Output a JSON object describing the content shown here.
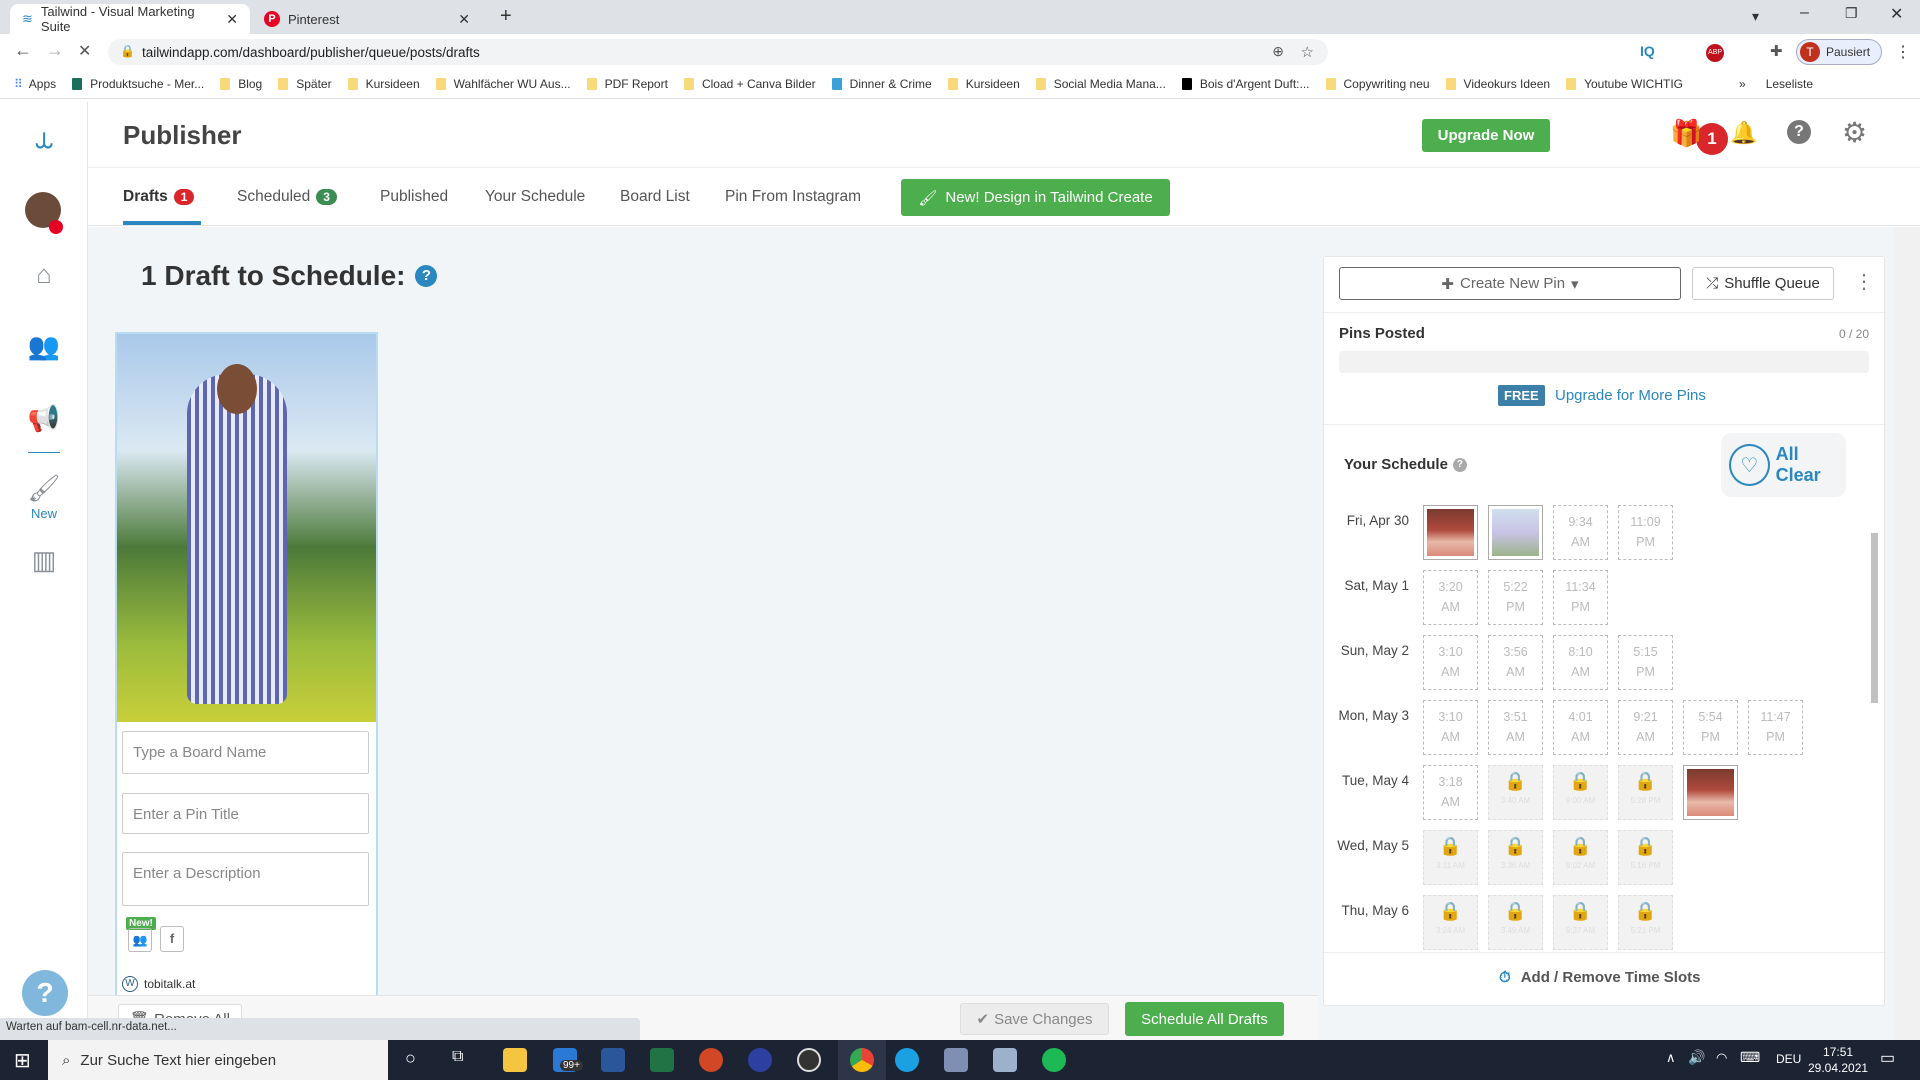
{
  "browser": {
    "tabs": [
      {
        "title": "Tailwind - Visual Marketing Suite",
        "active": true
      },
      {
        "title": "Pinterest",
        "active": false
      }
    ],
    "url": "tailwindapp.com/dashboard/publisher/queue/posts/drafts",
    "profile_label": "Pausiert",
    "profile_initial": "T",
    "bookmarks": [
      "Apps",
      "Produktsuche - Mer...",
      "Blog",
      "Später",
      "Kursideen",
      "Wahlfächer WU Aus...",
      "PDF Report",
      "Cload + Canva Bilder",
      "Dinner & Crime",
      "Kursideen",
      "Social Media Mana...",
      "Bois d'Argent Duft:...",
      "Copywriting neu",
      "Videokurs Ideen",
      "Youtube WICHTIG"
    ],
    "reading_list": "Leseliste",
    "status_text": "Warten auf bam-cell.nr-data.net..."
  },
  "sidebar": {
    "new_label": "New"
  },
  "header": {
    "title": "Publisher",
    "upgrade_label": "Upgrade Now",
    "notification_count": "1"
  },
  "tabs": [
    {
      "label": "Drafts",
      "count": "1",
      "active": true
    },
    {
      "label": "Scheduled",
      "count": "3"
    },
    {
      "label": "Published"
    },
    {
      "label": "Your Schedule"
    },
    {
      "label": "Board List"
    },
    {
      "label": "Pin From Instagram"
    }
  ],
  "design_button": "New! Design in Tailwind Create",
  "drafts": {
    "heading": "1 Draft to Schedule:",
    "board_placeholder": "Type a Board Name",
    "title_placeholder": "Enter a Pin Title",
    "description_placeholder": "Enter a Description",
    "new_badge": "New!",
    "site": "tobitalk.at",
    "remove_all": "Remove All",
    "save_changes": "Save Changes",
    "schedule_all": "Schedule All Drafts"
  },
  "panel": {
    "create_new_pin": "Create New Pin",
    "shuffle_queue": "Shuffle Queue",
    "pins_posted_label": "Pins Posted",
    "pins_posted_value": "0 / 20",
    "pins_posted_fraction": 0,
    "free_badge": "FREE",
    "upgrade_link": "Upgrade for More Pins",
    "schedule_title": "Your Schedule",
    "all_clear": "All Clear",
    "add_remove_slots": "Add / Remove Time Slots",
    "days": [
      {
        "label": "Fri, Apr 30",
        "slots": [
          {
            "type": "pin"
          },
          {
            "type": "pin2"
          },
          {
            "type": "open",
            "time": "9:34",
            "ampm": "AM"
          },
          {
            "type": "open",
            "time": "11:09",
            "ampm": "PM"
          }
        ]
      },
      {
        "label": "Sat, May 1",
        "slots": [
          {
            "type": "open",
            "time": "3:20",
            "ampm": "AM"
          },
          {
            "type": "open",
            "time": "5:22",
            "ampm": "PM"
          },
          {
            "type": "open",
            "time": "11:34",
            "ampm": "PM"
          }
        ]
      },
      {
        "label": "Sun, May 2",
        "slots": [
          {
            "type": "open",
            "time": "3:10",
            "ampm": "AM"
          },
          {
            "type": "open",
            "time": "3:56",
            "ampm": "AM"
          },
          {
            "type": "open",
            "time": "8:10",
            "ampm": "AM"
          },
          {
            "type": "open",
            "time": "5:15",
            "ampm": "PM"
          }
        ]
      },
      {
        "label": "Mon, May 3",
        "slots": [
          {
            "type": "open",
            "time": "3:10",
            "ampm": "AM"
          },
          {
            "type": "open",
            "time": "3:51",
            "ampm": "AM"
          },
          {
            "type": "open",
            "time": "4:01",
            "ampm": "AM"
          },
          {
            "type": "open",
            "time": "9:21",
            "ampm": "AM"
          },
          {
            "type": "open",
            "time": "5:54",
            "ampm": "PM"
          },
          {
            "type": "open",
            "time": "11:47",
            "ampm": "PM"
          }
        ]
      },
      {
        "label": "Tue, May 4",
        "slots": [
          {
            "type": "open",
            "time": "3:18",
            "ampm": "AM"
          },
          {
            "type": "locked",
            "time": "3:40 AM"
          },
          {
            "type": "locked",
            "time": "9:00 AM"
          },
          {
            "type": "locked",
            "time": "5:28 PM"
          },
          {
            "type": "pin"
          }
        ]
      },
      {
        "label": "Wed, May 5",
        "slots": [
          {
            "type": "locked",
            "time": "3:11 AM"
          },
          {
            "type": "locked",
            "time": "3:36 AM"
          },
          {
            "type": "locked",
            "time": "9:02 AM"
          },
          {
            "type": "locked",
            "time": "5:16 PM"
          }
        ]
      },
      {
        "label": "Thu, May 6",
        "slots": [
          {
            "type": "locked",
            "time": "3:24 AM"
          },
          {
            "type": "locked",
            "time": "3:49 AM"
          },
          {
            "type": "locked",
            "time": "9:37 AM"
          },
          {
            "type": "locked",
            "time": "5:21 PM"
          }
        ]
      }
    ]
  },
  "taskbar": {
    "search_placeholder": "Zur Suche Text hier eingeben",
    "mail_badge": "99+",
    "language": "DEU",
    "time": "17:51",
    "date": "29.04.2021"
  },
  "colors": {
    "green": "#4cae4c",
    "accent_blue": "#2a87c0",
    "free_badge": "#3c7fa8",
    "red": "#d9262b"
  }
}
